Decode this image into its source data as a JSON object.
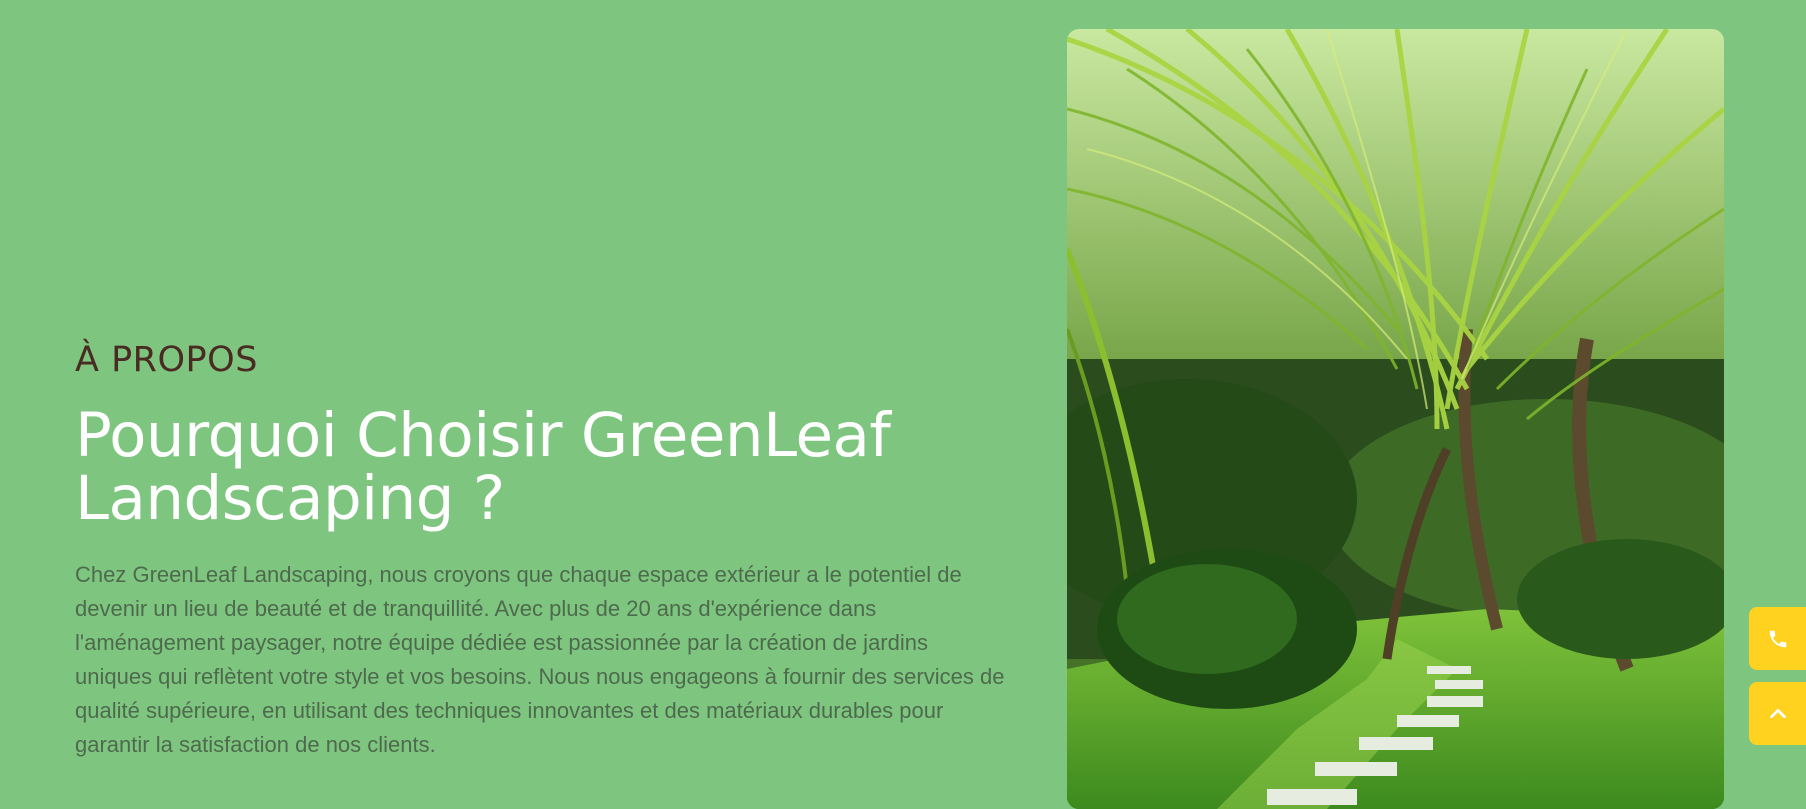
{
  "about": {
    "eyebrow": "À PROPOS",
    "heading_line1": "Pourquoi Choisir GreenLeaf",
    "heading_line2": "Landscaping ?",
    "paragraph": "Chez GreenLeaf Landscaping, nous croyons que chaque espace extérieur a le potentiel de devenir un lieu de beauté et de tranquillité. Avec plus de 20 ans d'expérience dans l'aménagement paysager, notre équipe dédiée est passionnée par la création de jardins uniques qui reflètent votre style et vos besoins. Nous nous engageons à fournir des services de qualité supérieure, en utilisant des techniques innovantes et des matériaux durables pour garantir la satisfaction de nos clients."
  },
  "image": {
    "subject": "tropical garden with palm trees and stepping stone path"
  },
  "floating_buttons": {
    "call_icon": "phone-icon",
    "top_icon": "chevron-up-icon"
  },
  "colors": {
    "background": "#7ec67f",
    "eyebrow": "#4a2b24",
    "heading": "#ffffff",
    "paragraph": "#4e6a4e",
    "floating_button": "#ffd21f"
  }
}
